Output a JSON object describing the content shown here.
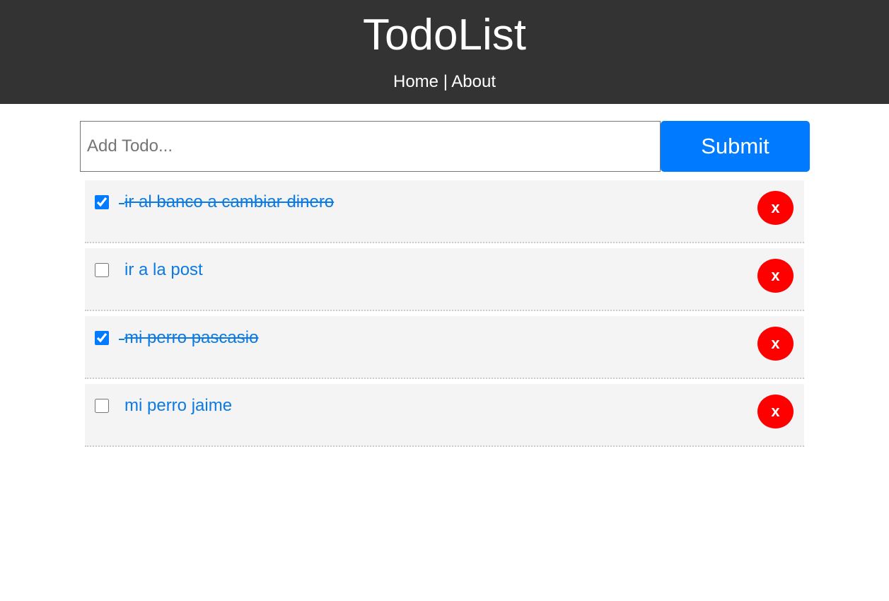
{
  "header": {
    "title": "TodoList",
    "nav": {
      "home": "Home",
      "separator": " | ",
      "about": "About"
    }
  },
  "form": {
    "input_value": "",
    "placeholder": "Add Todo...",
    "submit_label": "Submit"
  },
  "todos": [
    {
      "title": "ir al banco a cambiar dinero",
      "completed": true,
      "delete_label": "x"
    },
    {
      "title": "ir a la post",
      "completed": false,
      "delete_label": "x"
    },
    {
      "title": "mi perro pascasio",
      "completed": true,
      "delete_label": "x"
    },
    {
      "title": "mi perro jaime",
      "completed": false,
      "delete_label": "x"
    }
  ],
  "colors": {
    "header_bg": "#333333",
    "accent": "#007bff",
    "delete": "#ff0000",
    "item_bg": "#f4f4f4",
    "todo_text": "#0c7ae2"
  }
}
